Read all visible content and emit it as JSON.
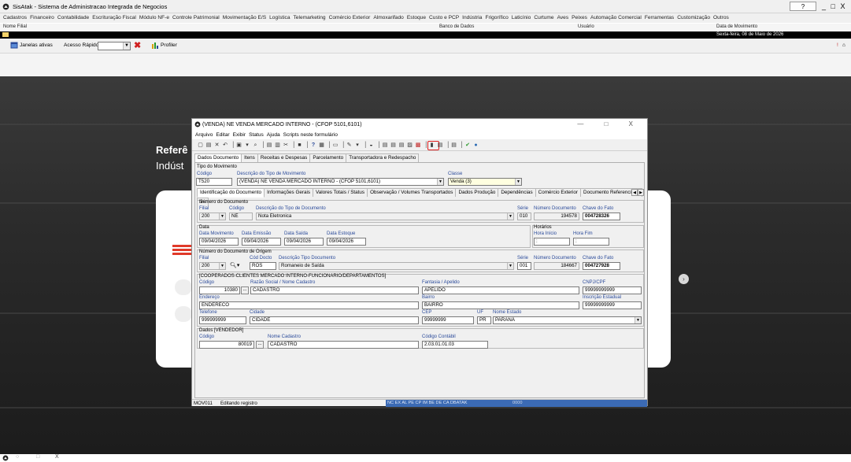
{
  "app": {
    "title": "SisAtak - Sistema de Administracao Integrada de Negocios",
    "help_button": "?",
    "window_buttons": "_ □ X"
  },
  "menu": [
    "Cadastros",
    "Financeiro",
    "Contabilidade",
    "Escrituração Fiscal",
    "Módulo NF-e",
    "Controle Patrimonial",
    "Movimentação E/S",
    "Logística",
    "Telemarketing",
    "Comércio Exterior",
    "Almoxarifado",
    "Estoque",
    "Custo e PCP",
    "Indústria",
    "Frigorífico",
    "Laticínio",
    "Curtume",
    "Aves",
    "Peixes",
    "Automação Comercial",
    "Ferramentas",
    "Customização",
    "Outros"
  ],
  "info_header": {
    "nome_filial": "Nome Filial",
    "banco_dados": "Banco de Dados",
    "usuario": "Usuário",
    "data_movimento": "Data de Movimento",
    "data_value": "Sexta-feira, 08 de Maio de 2026"
  },
  "toolbar": {
    "janelas": "Janelas ativas",
    "acesso_rapido": "Acesso Rápido",
    "profiler": "Profiler"
  },
  "background": {
    "heading1": "Referê",
    "heading2": "Indúst"
  },
  "taskbar": [
    "○",
    "□",
    "X"
  ],
  "window": {
    "title": "(VENDA) NE VENDA MERCADO INTERNO - (CFOP 5101,6101)",
    "controls": "— □ X",
    "menu": [
      "Arquivo",
      "Editar",
      "Exibir",
      "Status",
      "Ajuda",
      "Scripts neste formulário"
    ],
    "main_tabs": [
      "Dados Documento",
      "Itens",
      "Receitas e Despesas",
      "Parcelamento",
      "Transportadora e Redespacho"
    ],
    "tipo_movimento": {
      "group": "Tipo do Movimento",
      "codigo_lbl": "Código",
      "codigo": "T520",
      "descricao_lbl": "Descrição do Tipo de Movimento",
      "descricao": "(VENDA) NE VENDA MERCADO INTERNO - (CFOP 5101,6101)",
      "classe_lbl": "Classe",
      "classe": "Venda (3)"
    },
    "sub_tabs": [
      "Identificação do Documento",
      "Informações Gerais",
      "Valores Totais / Status",
      "Observação / Volumes Transportados",
      "Dados Produção",
      "Dependências",
      "Comércio Exterior",
      "Documento Referenciado",
      "3<"
    ],
    "numero_documento": {
      "group": "Número do Documento",
      "filial_lbl": "Filial",
      "filial": "200",
      "codigo_lbl": "Código",
      "codigo": "NE",
      "desc_lbl": "Descrição do Tipo de Documento",
      "desc": "Nota Eletronica",
      "serie_lbl": "Série",
      "serie": "010",
      "numero_lbl": "Número Documento",
      "numero": "194578",
      "chave_lbl": "Chave do Fato",
      "chave": "004728326"
    },
    "data": {
      "group": "Data",
      "mov_lbl": "Data Movimento",
      "mov": "09/04/2026",
      "emissao_lbl": "Data Emissão",
      "emissao": "09/04/2026",
      "saida_lbl": "Data Saída",
      "saida": "09/04/2026",
      "estoque_lbl": "Data Estoque",
      "estoque": "09/04/2026",
      "horarios": "Horários",
      "hora_ini_lbl": "Hora Início",
      "hora_ini": ":",
      "hora_fim_lbl": "Hora Fim",
      "hora_fim": ":"
    },
    "origem": {
      "group": "Número do Documento de Origem",
      "filial_lbl": "Filial",
      "filial": "200",
      "cod_lbl": "Cód Docto",
      "cod": "ROS",
      "desc_lbl": "Descrição Tipo Documento",
      "desc": "Romaneio de Saída",
      "serie_lbl": "Série",
      "serie": "001",
      "numero_lbl": "Número Documento",
      "numero": "184667",
      "chave_lbl": "Chave do Fato",
      "chave": "004727928"
    },
    "cliente": {
      "group": "[COOPERADOS-CLIENTES MERCADO INTERNO-FUNCIONARIO/DEPARTAMENTOS]",
      "codigo_lbl": "Código",
      "codigo": "10380",
      "razao_lbl": "Razão Social / Nome Cadastro",
      "razao": "CADASTRO",
      "fantasia_lbl": "Fantasia / Apelido",
      "fantasia": "APELIDO",
      "cnpj_lbl": "CNPJ/CPF",
      "cnpj": "99999999999",
      "endereco_lbl": "Endereço",
      "endereco": "ENDERECO",
      "bairro_lbl": "Bairro",
      "bairro": "BAIRRO",
      "ie_lbl": "Inscrição Estadual",
      "ie": "99999999999",
      "telefone_lbl": "Telefone",
      "telefone": "999999999",
      "cidade_lbl": "Cidade",
      "cidade": "CIDADE",
      "cep_lbl": "CEP",
      "cep": "99999999",
      "uf_lbl": "UF",
      "uf": "PR",
      "estado_lbl": "Nome Estado",
      "estado": "PARANÁ"
    },
    "vendedor": {
      "group": "Dados [VENDEDOR]",
      "codigo_lbl": "Código",
      "codigo": "80019",
      "nome_lbl": "Nome Cadastro",
      "nome": "CADASTRO",
      "contabil_lbl": "Código Contábil",
      "contabil": "2.03.01.01.03"
    },
    "status": {
      "screen": "MOV011",
      "mode": "Editando registro",
      "flags": "NC EX AL PE CP IM BE DE CA DBATAK",
      "code": "0000"
    }
  },
  "colors": {
    "highlight": "#e02020",
    "label_blue": "#2a4a9a",
    "status_blue": "#3b6ab4"
  }
}
